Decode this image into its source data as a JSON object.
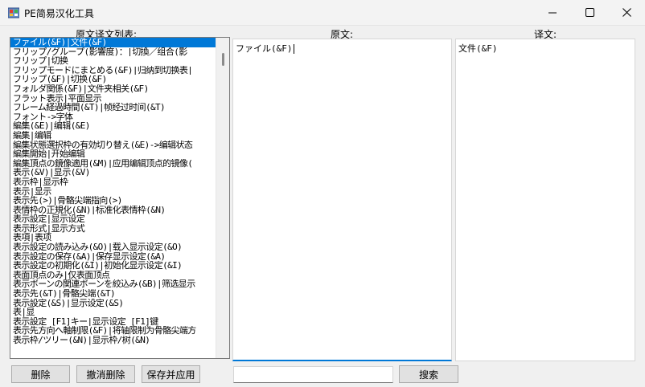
{
  "window": {
    "title": "PE简易汉化工具"
  },
  "labels": {
    "list_header": "原文译文列表:",
    "original_header": "原文:",
    "translation_header": "译文:"
  },
  "list": {
    "items": [
      "ファイル(&F)|文件(&F)",
      "フリップ/グループ(影響度)：|切換／组合(影",
      "フリップ|切换",
      "フリップモードにまとめる(&F)|归纳到切换表|",
      "フリップ(&F)|切换(&F)",
      "フォルダ関係(&F)|文件夹相关(&F)",
      "フラット表示|平面显示",
      "フレーム経過時間(&T)|帧经过时间(&T)",
      "フォント->字体",
      "編集(&E)|编辑(&E)",
      "編集|编辑",
      "編集状態選択枠の有効切り替え(&E)->编辑状态",
      "編集開始|开始编辑",
      "編集頂点の鏡像適用(&M)|应用编辑顶点的镜像(",
      "表示(&V)|显示(&V)",
      "表示枠|显示枠",
      "表示|显示",
      "表示先(>)|骨骼尖端指向(>)",
      "表情枠の正規化(&N)|标准化表情枠(&N)",
      "表示設定|显示设定",
      "表示形式|显示方式",
      "表項|表项",
      "表示設定の読み込み(&O)|载入显示设定(&O)",
      "表示設定の保存(&A)|保存显示设定(&A)",
      "表示設定の初期化(&I)|初始化显示设定(&I)",
      "表面頂点のみ|仅表面顶点",
      "表示ボーンの関連ボーンを絞込み(&B)|筛选显示",
      "表示先(&T)|骨骼尖端(&T)",
      "表示設定(&S)|显示设定(&S)",
      "表|显",
      "表示設定 [F1]キー|显示设定 [F1]键",
      "表示先方向へ軸制限(&F)|将轴限制为骨骼尖端方",
      "表示枠/ツリー(&N)|显示枠/树(&N)"
    ],
    "selected_index": 0
  },
  "original_text": "ファイル(&F)",
  "translation_text": "文件(&F)",
  "buttons": {
    "delete": "删除",
    "undo_delete": "撤消删除",
    "save_apply": "保存并应用",
    "search": "搜索"
  },
  "search": {
    "value": ""
  }
}
